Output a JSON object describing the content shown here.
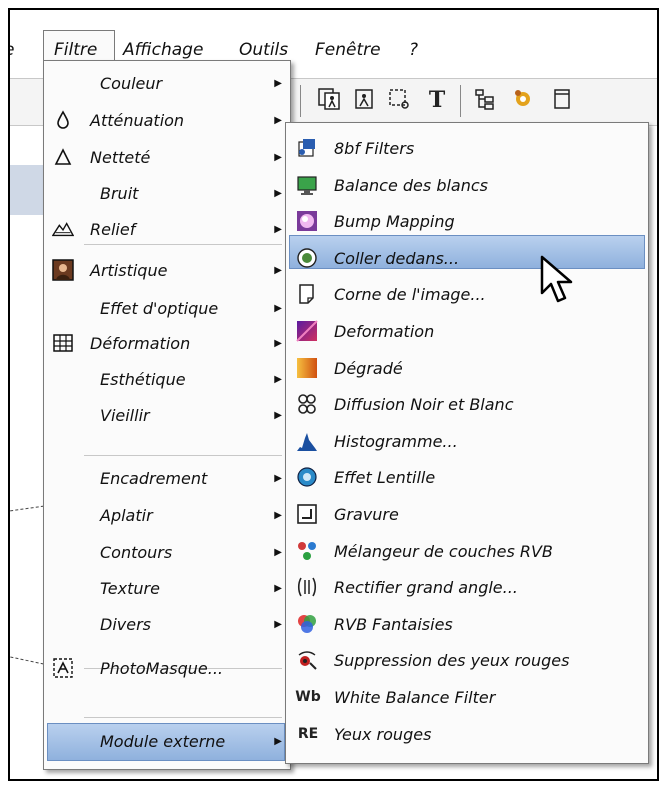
{
  "menubar": {
    "items": [
      "e",
      "Filtre",
      "Affichage",
      "Outils",
      "Fenêtre",
      "?"
    ]
  },
  "filter_menu": {
    "items": [
      {
        "label": "Couleur",
        "submenu": true
      },
      {
        "label": "Atténuation",
        "submenu": true,
        "icon": "drop-outline-icon"
      },
      {
        "label": "Netteté",
        "submenu": true,
        "icon": "triangle-outline-icon"
      },
      {
        "label": "Bruit",
        "submenu": true
      },
      {
        "label": "Relief",
        "submenu": true,
        "icon": "mountain-icon"
      },
      {
        "label": "Artistique",
        "submenu": true,
        "icon": "portrait-icon"
      },
      {
        "label": "Effet d'optique",
        "submenu": true
      },
      {
        "label": "Déformation",
        "submenu": true,
        "icon": "grid-icon"
      },
      {
        "label": "Esthétique",
        "submenu": true
      },
      {
        "label": "Vieillir",
        "submenu": true
      },
      {
        "label": "Encadrement",
        "submenu": true
      },
      {
        "label": "Aplatir",
        "submenu": true
      },
      {
        "label": "Contours",
        "submenu": true
      },
      {
        "label": "Texture",
        "submenu": true
      },
      {
        "label": "Divers",
        "submenu": true
      },
      {
        "label": "PhotoMasque...",
        "submenu": false,
        "icon": "photomask-icon"
      },
      {
        "label": "Module externe",
        "submenu": true
      }
    ]
  },
  "plugin_menu": {
    "items": [
      {
        "label": "8bf Filters",
        "icon": "plugin-icon",
        "icon_text": "",
        "color": "#2a5db0"
      },
      {
        "label": "Balance des blancs",
        "icon": "monitor-icon",
        "icon_text": "",
        "color": "#3aa34a"
      },
      {
        "label": "Bump Mapping",
        "icon": "bump-icon",
        "icon_text": "",
        "color": "#c060c0"
      },
      {
        "label": "Coller dedans...",
        "icon": "paste-into-icon",
        "icon_text": "",
        "color": "#4a8a3a"
      },
      {
        "label": "Corne de l'image...",
        "icon": "page-corner-icon",
        "icon_text": "",
        "color": "#444444"
      },
      {
        "label": "Deformation",
        "icon": "deform-icon",
        "icon_text": "",
        "color": "#9b2aa0"
      },
      {
        "label": "Dégradé",
        "icon": "gradient-icon",
        "icon_text": "",
        "color": "#e08a10"
      },
      {
        "label": "Diffusion Noir et Blanc",
        "icon": "diffusion-icon",
        "icon_text": "",
        "color": "#222222"
      },
      {
        "label": "Histogramme...",
        "icon": "histogram-icon",
        "icon_text": "",
        "color": "#1a4fa0"
      },
      {
        "label": "Effet Lentille",
        "icon": "lens-icon",
        "icon_text": "",
        "color": "#2a8ac8"
      },
      {
        "label": "Gravure",
        "icon": "engrave-icon",
        "icon_text": "",
        "color": "#333333"
      },
      {
        "label": "Mélangeur de couches RVB",
        "icon": "rgb-mixer-icon",
        "icon_text": "",
        "color": "#d03a3a"
      },
      {
        "label": "Rectifier grand angle...",
        "icon": "wide-angle-icon",
        "icon_text": "",
        "color": "#333333"
      },
      {
        "label": "RVB Fantaisies",
        "icon": "rgb-fantasy-icon",
        "icon_text": "",
        "color": "#d03a3a"
      },
      {
        "label": "Suppression des yeux rouges",
        "icon": "red-eye-icon",
        "icon_text": "",
        "color": "#c02020"
      },
      {
        "label": "White Balance Filter",
        "icon": "wb-icon",
        "icon_text": "Wb",
        "color": "#222222"
      },
      {
        "label": "Yeux rouges",
        "icon": "re-icon",
        "icon_text": "RE",
        "color": "#222222"
      }
    ]
  },
  "toolbar": {
    "text_tool_glyph": "T"
  }
}
